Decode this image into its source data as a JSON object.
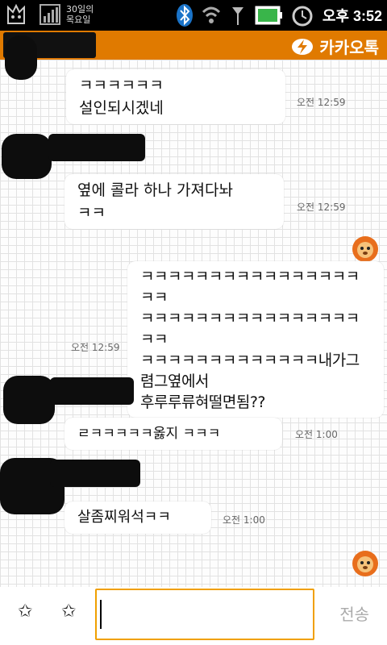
{
  "status_bar": {
    "date": "30일의 목요일",
    "time": "오후 3:52"
  },
  "title_bar": {
    "brand": "카카오톡"
  },
  "messages": [
    {
      "side": "left",
      "lines": [
        "ㅋㅋㅋㅋㅋㅋ",
        "설인되시겠네"
      ],
      "time": "오전 12:59"
    },
    {
      "side": "left",
      "lines": [
        "옆에 콜라 하나 가져다놔",
        "ㅋㅋ"
      ],
      "time": "오전 12:59"
    },
    {
      "side": "right",
      "lines": [
        "ㅋㅋㅋㅋㅋㅋㅋㅋㅋㅋㅋㅋㅋㅋㅋㅋㅋㅋ",
        "ㅋㅋㅋㅋㅋㅋㅋㅋㅋㅋㅋㅋㅋㅋㅋㅋㅋㅋ",
        "ㅋㅋㅋㅋㅋㅋㅋㅋㅋㅋㅋㅋㅋ내가그",
        "렴그옆에서",
        "후루루류혀떨면됨??"
      ],
      "time": "오전 12:59"
    },
    {
      "side": "left",
      "lines": [
        "ㄹㅋㅋㅋㅋㅋ옳지 ㅋㅋㅋ"
      ],
      "time": "오전 1:00"
    },
    {
      "side": "left",
      "lines": [
        "살좀찌워석ㅋㅋ"
      ],
      "time": "오전 1:00"
    }
  ],
  "input_bar": {
    "send_label": "전송",
    "input_value": ""
  }
}
